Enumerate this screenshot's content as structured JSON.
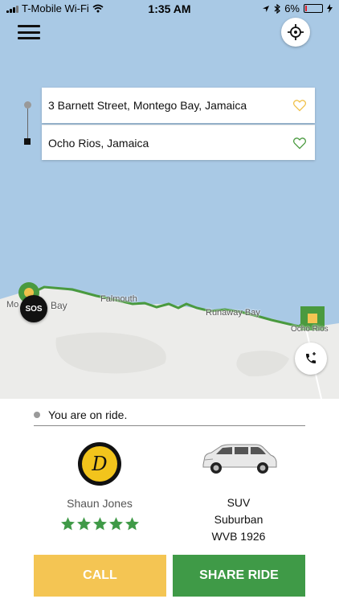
{
  "status_bar": {
    "carrier": "T-Mobile Wi-Fi",
    "time": "1:35 AM",
    "battery": "6%"
  },
  "route": {
    "pickup": "3 Barnett Street, Montego Bay, Jamaica",
    "dropoff": "Ocho Rios, Jamaica"
  },
  "map": {
    "labels": {
      "montego_bay_a": "Mo",
      "montego_bay_b": "Bay",
      "falmouth": "Falmouth",
      "runaway_bay": "Runaway Bay",
      "ocho_rios": "Ocho Rios"
    },
    "sos_label": "SOS"
  },
  "ride": {
    "status": "You are on ride.",
    "driver": {
      "initial": "D",
      "name": "Shaun Jones",
      "rating": 5,
      "rating_max": 5
    },
    "vehicle": {
      "type": "SUV",
      "model": "Suburban",
      "plate": "WVB 1926"
    }
  },
  "actions": {
    "call": "CALL",
    "share": "SHARE RIDE"
  },
  "colors": {
    "water": "#a9c9e5",
    "land": "#ececea",
    "route": "#4a9a3f",
    "call": "#f4c553",
    "share": "#3f9a47",
    "star": "#3f9a47",
    "heart_pickup": "#f0c14b",
    "heart_dropoff": "#4a9a3f"
  },
  "icons": {
    "menu": "menu-icon",
    "locate": "crosshair-icon",
    "heart": "heart-outline-icon",
    "phone": "phone-icon",
    "wifi": "wifi-icon",
    "location_arrow": "location-arrow-icon",
    "bluetooth": "bluetooth-icon",
    "charging": "bolt-icon"
  }
}
